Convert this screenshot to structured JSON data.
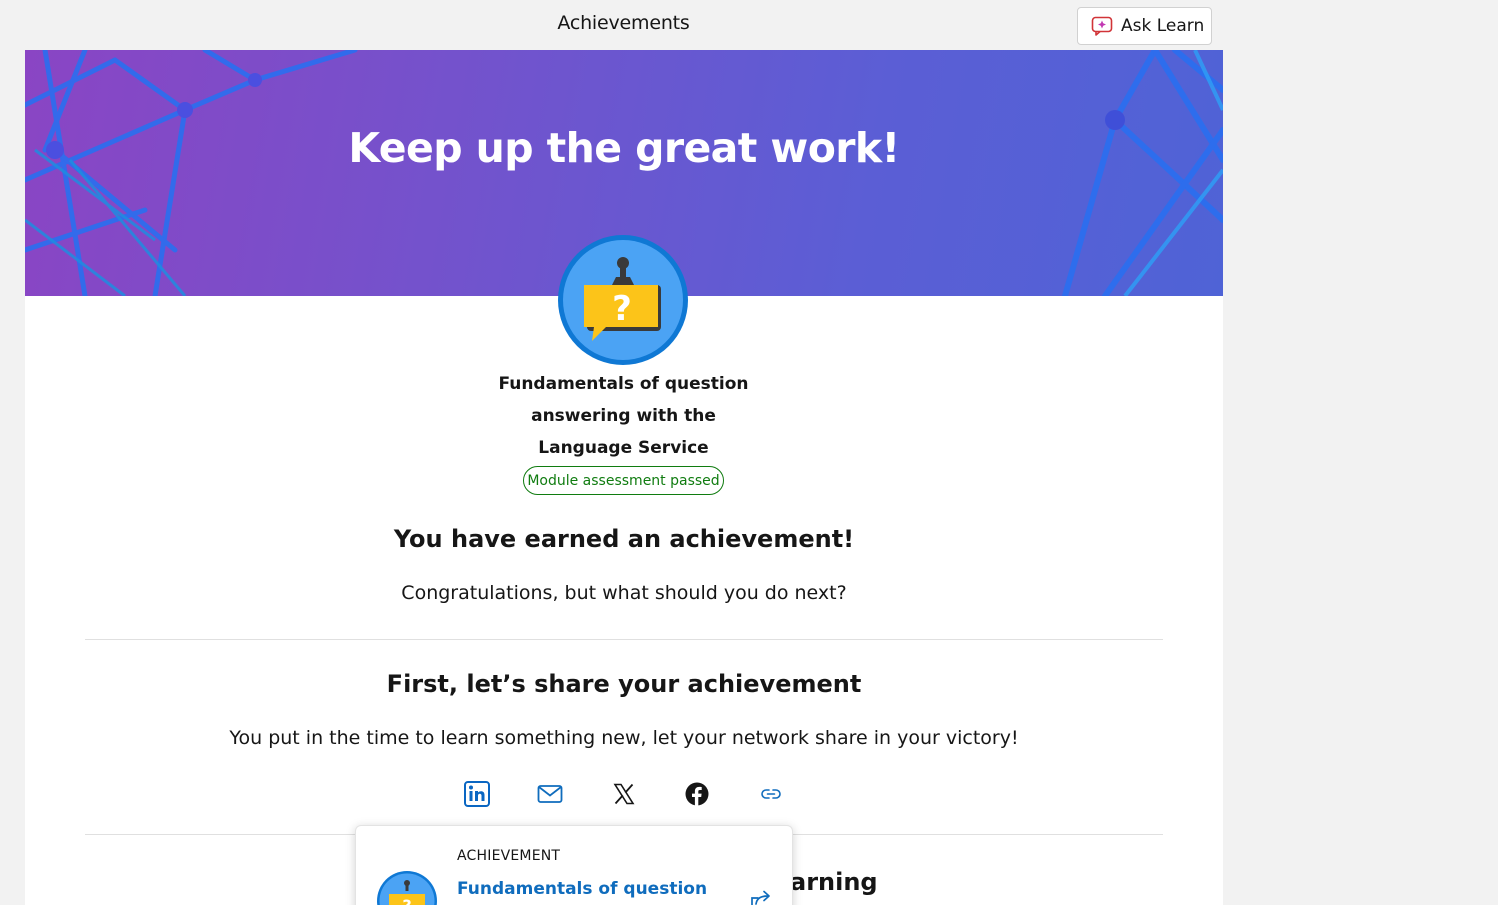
{
  "header": {
    "title": "Achievements",
    "ask_learn_label": "Ask Learn"
  },
  "hero": {
    "title": "Keep up the great work!"
  },
  "module": {
    "name": "Fundamentals of question answering with the Language Service",
    "status": "Module assessment passed",
    "badge_icon": "question-speech-bubble-icon"
  },
  "earned": {
    "heading": "You have earned an achievement!",
    "subtitle": "Congratulations, but what should you do next?"
  },
  "share": {
    "heading": "First, let’s share your achievement",
    "description": "You put in the time to learn something new, let your network share in your victory!",
    "buttons": [
      "linkedin-icon",
      "email-icon",
      "x-icon",
      "facebook-icon",
      "link-icon"
    ]
  },
  "next_section": {
    "heading_visible": "arning"
  },
  "popup": {
    "type": "ACHIEVEMENT",
    "title": "Fundamentals of question"
  },
  "colors": {
    "accent": "#0f6cbd",
    "success": "#107c10",
    "hero_start": "#8a45c4",
    "hero_end": "#4f63d6"
  }
}
